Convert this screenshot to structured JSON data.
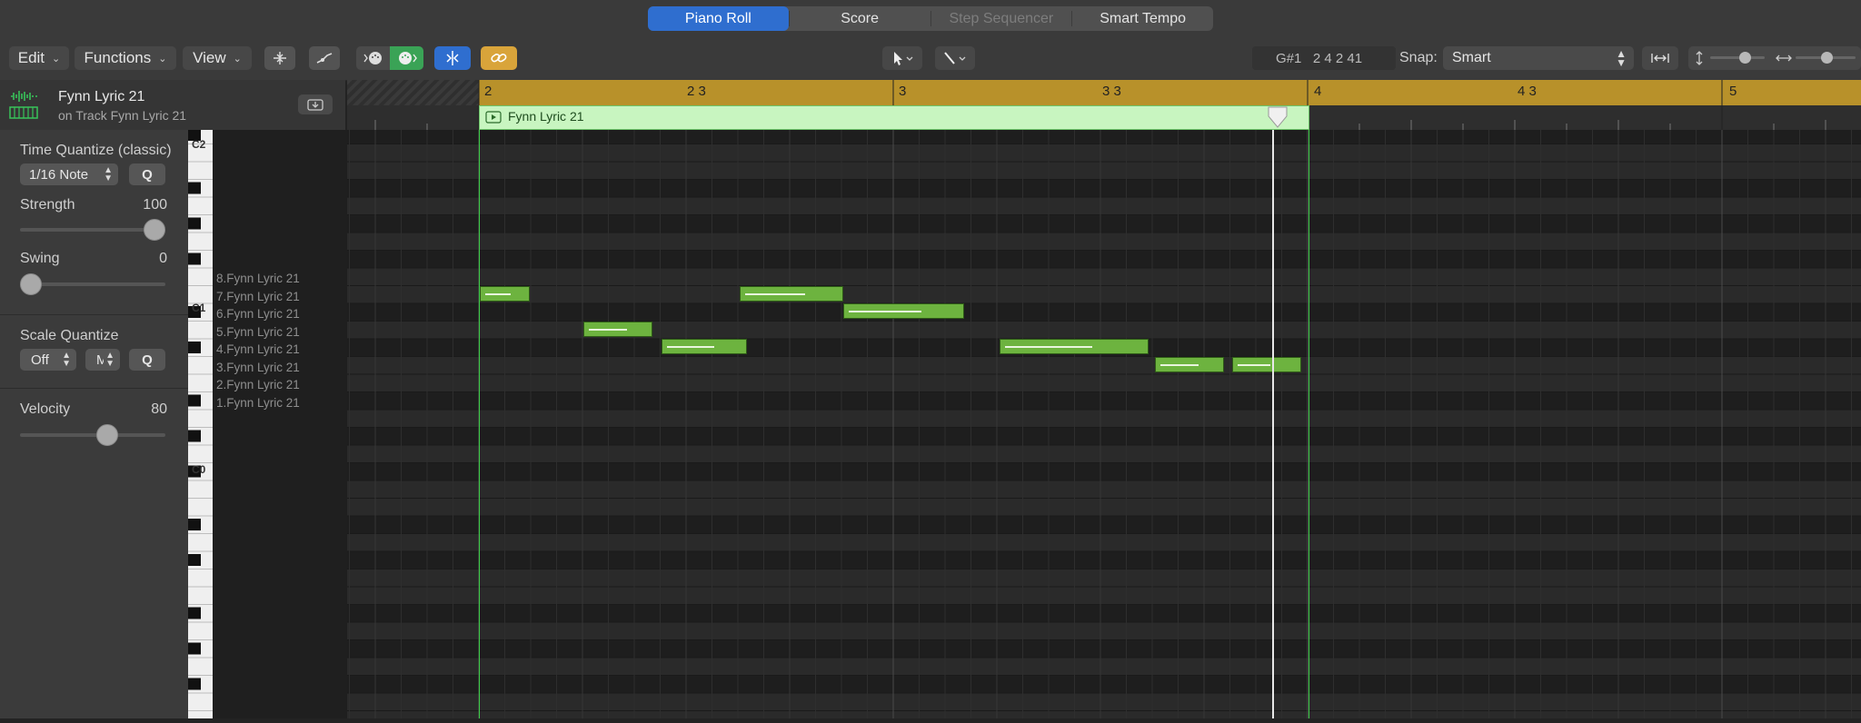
{
  "tabs": [
    {
      "label": "Piano Roll",
      "state": "active"
    },
    {
      "label": "Score",
      "state": "normal"
    },
    {
      "label": "Step Sequencer",
      "state": "disabled"
    },
    {
      "label": "Smart Tempo",
      "state": "normal"
    }
  ],
  "toolbar": {
    "edit_label": "Edit",
    "functions_label": "Functions",
    "view_label": "View",
    "position_readout": "G#1   2 4 2 41",
    "snap_label": "Snap:",
    "snap_value": "Smart"
  },
  "region_header": {
    "title": "Fynn Lyric 21",
    "subtitle": "on Track Fynn Lyric 21"
  },
  "inspector": {
    "time_quantize_label": "Time Quantize (classic)",
    "quantize_value": "1/16 Note",
    "q_label": "Q",
    "strength_label": "Strength",
    "strength_value": "100",
    "strength_level": 1.0,
    "swing_label": "Swing",
    "swing_value": "0",
    "swing_level": 0.0,
    "scale_quantize_label": "Scale Quantize",
    "scale_off": "Off",
    "scale_mode": "M",
    "velocity_label": "Velocity",
    "velocity_value": "80",
    "velocity_level": 0.63
  },
  "keyboard_labels": [
    "C2",
    "C1",
    "C0"
  ],
  "lane_names": [
    "8.Fynn Lyric 21",
    "7.Fynn Lyric 21",
    "6.Fynn Lyric 21",
    "5.Fynn Lyric 21",
    "4.Fynn Lyric 21",
    "3.Fynn Lyric 21",
    "2.Fynn Lyric 21",
    "1.Fynn Lyric 21"
  ],
  "ruler_labels": [
    "2",
    "2 3",
    "3",
    "3 3",
    "4",
    "4 3",
    "5"
  ],
  "region_name": "Fynn Lyric 21",
  "colors": {
    "accent_blue": "#2f6ecf",
    "ruler_gold": "#b8912a",
    "region_green": "#c8f5c0",
    "note_green": "#6db33f",
    "link_yellow": "#d9a43a"
  }
}
